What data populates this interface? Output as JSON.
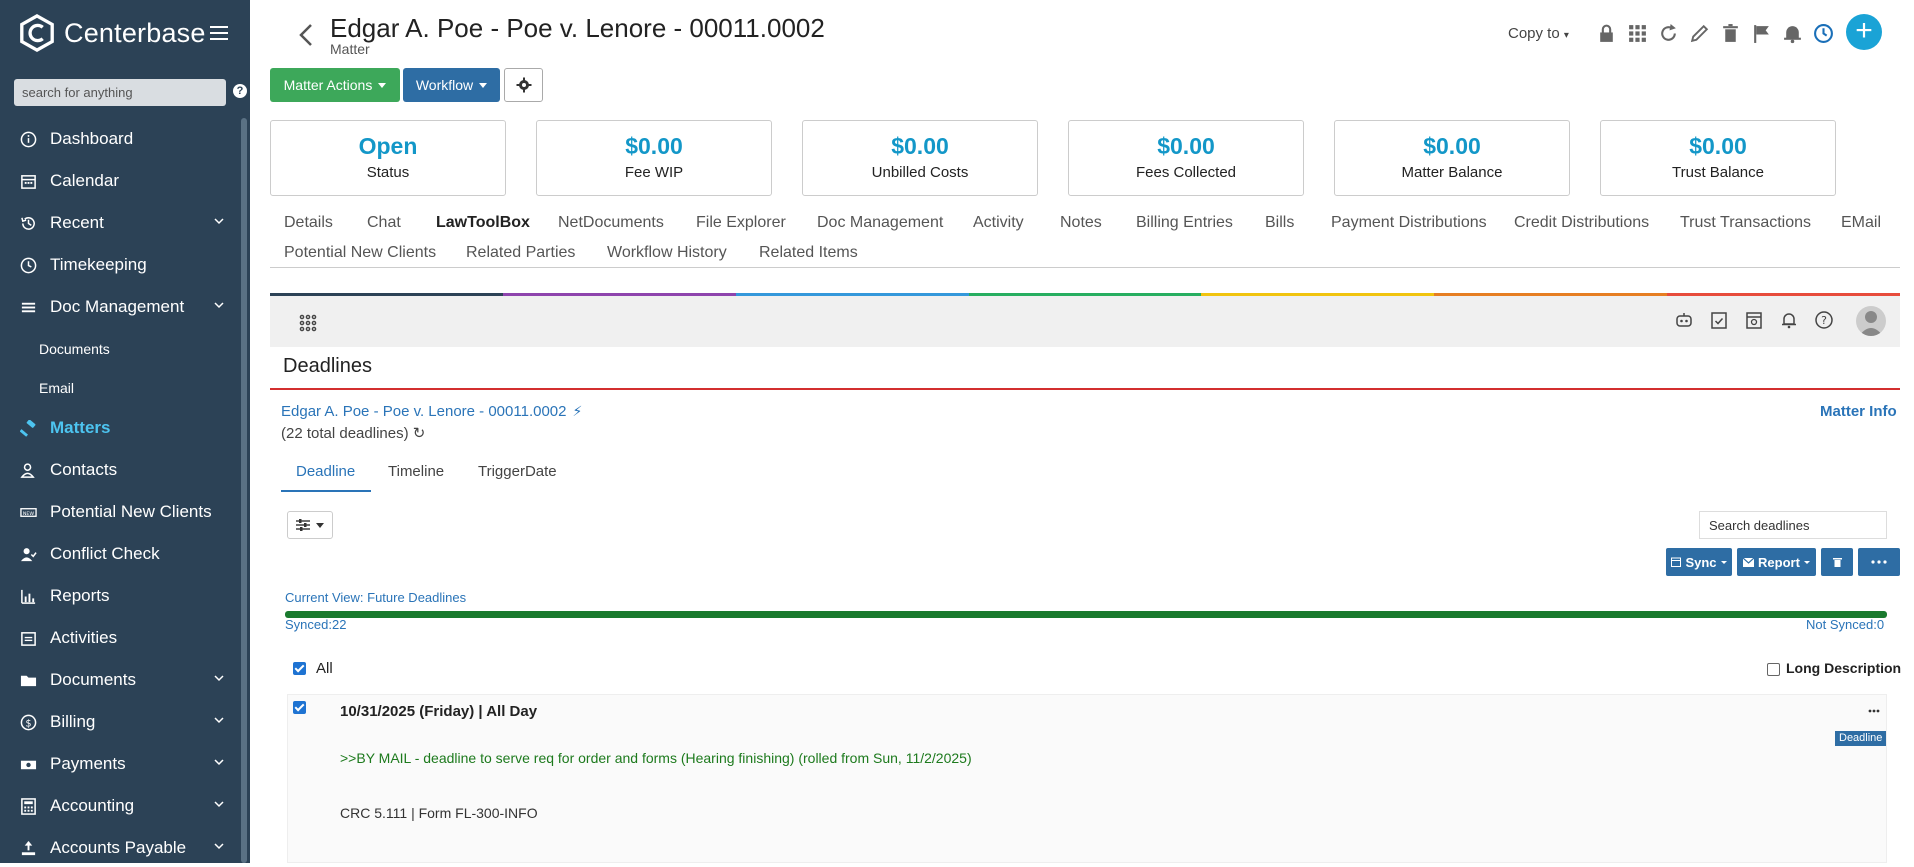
{
  "sidebar": {
    "brand": "Centerbase",
    "search_placeholder": "search for anything",
    "help": "?",
    "items": [
      {
        "label": "Dashboard"
      },
      {
        "label": "Calendar"
      },
      {
        "label": "Recent"
      },
      {
        "label": "Timekeeping"
      },
      {
        "label": "Doc Management"
      },
      {
        "label": "Documents"
      },
      {
        "label": "Email"
      },
      {
        "label": "Matters"
      },
      {
        "label": "Contacts"
      },
      {
        "label": "Potential New Clients"
      },
      {
        "label": "Conflict Check"
      },
      {
        "label": "Reports"
      },
      {
        "label": "Activities"
      },
      {
        "label": "Documents"
      },
      {
        "label": "Billing"
      },
      {
        "label": "Payments"
      },
      {
        "label": "Accounting"
      },
      {
        "label": "Accounts Payable"
      }
    ]
  },
  "header": {
    "title": "Edgar A. Poe - Poe v. Lenore - 00011.0002",
    "subtitle": "Matter",
    "copy_to": "Copy to",
    "plus": "+"
  },
  "actions": {
    "matter_actions": "Matter Actions",
    "workflow": "Workflow"
  },
  "cards": [
    {
      "value": "Open",
      "label": "Status"
    },
    {
      "value": "$0.00",
      "label": "Fee WIP"
    },
    {
      "value": "$0.00",
      "label": "Unbilled Costs"
    },
    {
      "value": "$0.00",
      "label": "Fees Collected"
    },
    {
      "value": "$0.00",
      "label": "Matter Balance"
    },
    {
      "value": "$0.00",
      "label": "Trust Balance"
    }
  ],
  "tabs": [
    {
      "label": "Details"
    },
    {
      "label": "Chat"
    },
    {
      "label": "LawToolBox"
    },
    {
      "label": "NetDocuments"
    },
    {
      "label": "File Explorer"
    },
    {
      "label": "Doc Management"
    },
    {
      "label": "Activity"
    },
    {
      "label": "Notes"
    },
    {
      "label": "Billing Entries"
    },
    {
      "label": "Bills"
    },
    {
      "label": "Payment Distributions"
    },
    {
      "label": "Credit Distributions"
    },
    {
      "label": "Trust Transactions"
    },
    {
      "label": "EMail"
    },
    {
      "label": "Potential New Clients"
    },
    {
      "label": "Related Parties"
    },
    {
      "label": "Workflow History"
    },
    {
      "label": "Related Items"
    }
  ],
  "ltb": {
    "heading": "Deadlines",
    "matter_link": "Edgar A. Poe - Poe v. Lenore - 00011.0002",
    "matter_info": "Matter Info",
    "total": "(22 total deadlines)",
    "subtabs": [
      {
        "label": "Deadline"
      },
      {
        "label": "Timeline"
      },
      {
        "label": "TriggerDate"
      }
    ],
    "search_placeholder": "Search deadlines",
    "sync": "Sync",
    "report": "Report",
    "current_view": "Current View: Future Deadlines",
    "sync_progress": 1.0,
    "synced": "Synced:22",
    "not_synced": "Not Synced:0",
    "all": "All",
    "long_description": "Long Description",
    "item": {
      "date": "10/31/2025 (Friday)  |  All Day",
      "badge": "Deadline",
      "desc": ">>BY MAIL - deadline to serve req for order and forms (Hearing finishing) (rolled from Sun, 11/2/2025)",
      "ref": "CRC 5.111 | Form FL-300-INFO"
    }
  },
  "colors": {
    "sidebar_bg": "#2c4256",
    "accent": "#1397c8",
    "active_nav": "#4dc4f0",
    "green_button": "#3da85a",
    "blue_button": "#2e6da4"
  }
}
